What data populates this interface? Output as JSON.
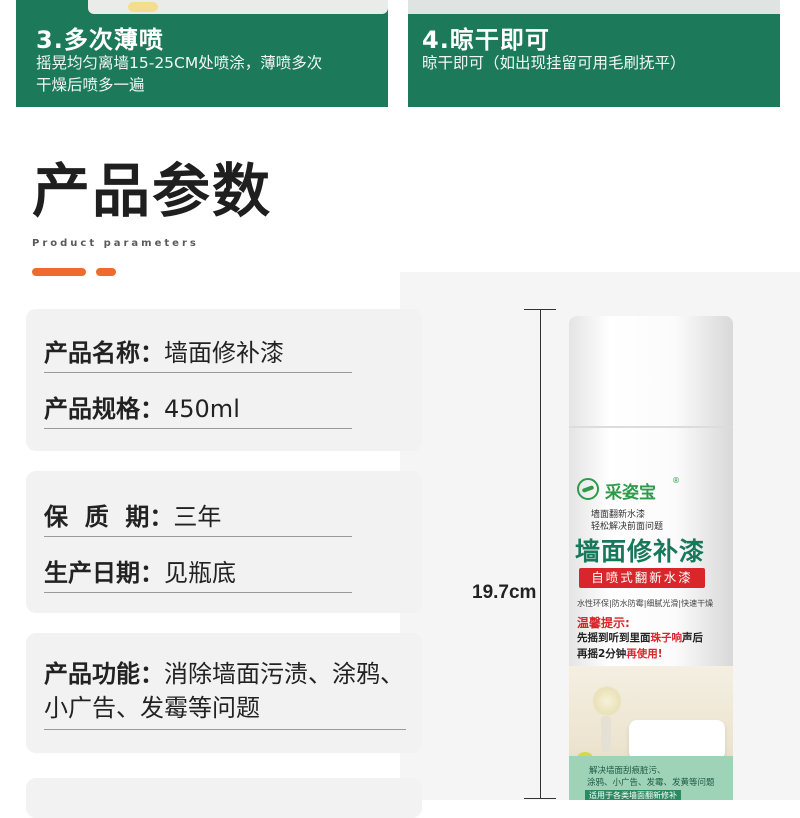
{
  "steps": [
    {
      "title": "3.多次薄喷",
      "desc_line1": "摇晃均匀离墙15-25CM处喷涂，薄喷多次",
      "desc_line2": "干燥后喷多一遍"
    },
    {
      "title": "4.晾干即可",
      "desc": "晾干即可（如出现挂留可用毛刷抚平）"
    }
  ],
  "section": {
    "title": "产品参数",
    "subtitle": "Product parameters"
  },
  "params": [
    {
      "key": "产品名称：",
      "value": "墙面修补漆"
    },
    {
      "key": "产品规格：",
      "value": "450ml"
    },
    {
      "key": "保  质  期：",
      "value": "三年"
    },
    {
      "key": "生产日期：",
      "value": "见瓶底"
    },
    {
      "key": "产品功能：",
      "value": "消除墙面污渍、涂鸦、小广告、发霉等问题"
    }
  ],
  "dimension": "19.7cm",
  "can": {
    "brand": "采姿宝",
    "registered": "®",
    "sub1": "墙面翻新水漆",
    "sub2": "轻松解决前面问题",
    "name": "墙面修补漆",
    "tag": "自喷式翻新水漆",
    "features": "水性环保|防水防霉|细腻光滑|快速干燥",
    "tip_title": "温馨提示:",
    "tip1_a": "先摇到听到里面",
    "tip1_hl": "珠子响",
    "tip1_b": "声后",
    "tip2_a": "再摇2分钟",
    "tip2_hl": "再使用!",
    "band1": "解决墙面刮痕脏污、",
    "band2": "涂鸦、小广告、发霉、发黄等问题",
    "band3": "适用于各类墙面翻新修补"
  },
  "colors": {
    "step_green": "#1c7a5a",
    "accent_orange": "#ee6a2e",
    "can_green": "#17795a",
    "can_red": "#d9262b"
  }
}
